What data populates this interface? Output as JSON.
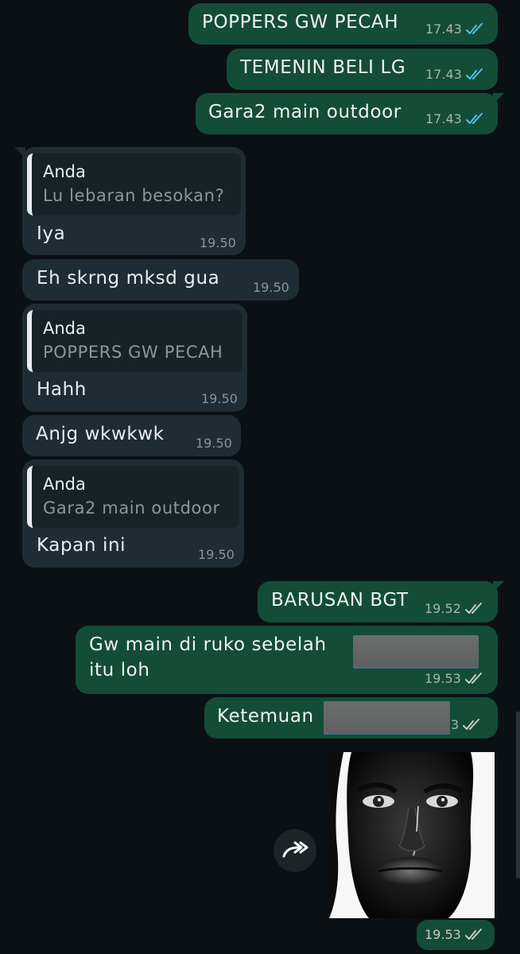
{
  "app": "WhatsApp chat",
  "colors": {
    "background": "#0b1014",
    "outgoing_bubble": "#134d37",
    "incoming_bubble": "#1f2c33",
    "read_tick": "#53bdeb",
    "delivered_tick": "#a7b5ad"
  },
  "messages": [
    {
      "direction": "out",
      "text": "POPPERS GW PECAH",
      "time": "17.43",
      "status": "read"
    },
    {
      "direction": "out",
      "text": "TEMENIN BELI LG",
      "time": "17.43",
      "status": "read"
    },
    {
      "direction": "out",
      "text": "Gara2 main outdoor",
      "time": "17.43",
      "status": "read"
    },
    {
      "direction": "in",
      "quote_author": "Anda",
      "quote_text": "Lu lebaran besokan?",
      "text": "Iya",
      "time": "19.50"
    },
    {
      "direction": "in",
      "text": "Eh skrng mksd gua",
      "time": "19.50"
    },
    {
      "direction": "in",
      "quote_author": "Anda",
      "quote_text": "POPPERS GW PECAH",
      "text": "Hahh",
      "time": "19.50"
    },
    {
      "direction": "in",
      "text": "Anjg wkwkwk",
      "time": "19.50"
    },
    {
      "direction": "in",
      "quote_author": "Anda",
      "quote_text": "Gara2 main outdoor",
      "text": "Kapan ini",
      "time": "19.50"
    },
    {
      "direction": "out",
      "text": "BARUSAN BGT",
      "time": "19.52",
      "status": "delivered"
    },
    {
      "direction": "out",
      "text_line1": "Gw main di ruko sebelah",
      "text_line2": "itu loh",
      "time": "19.53",
      "status": "delivered"
    },
    {
      "direction": "out",
      "text": "Ketemuan",
      "time_partial": "3",
      "status": "delivered"
    },
    {
      "direction": "out",
      "type": "image",
      "image_icon": "crying-face-photo",
      "forward_icon": "forward-icon",
      "time": "19.53",
      "status": "delivered"
    }
  ]
}
